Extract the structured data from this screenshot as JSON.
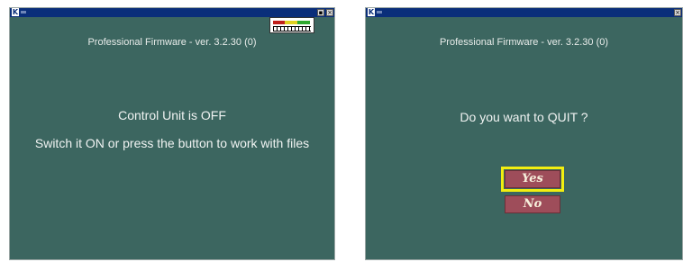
{
  "left_window": {
    "titlebar": {
      "app_icon": "k-icon",
      "buttons": [
        "minimize-icon",
        "close-icon"
      ]
    },
    "firmware": "Professional Firmware - ver. 3.2.30 (0)",
    "status_line1": "Control Unit is OFF",
    "status_line2": "Switch it ON or press the button to work with files",
    "meter": {
      "colors": [
        "#c0201c",
        "#e0d020",
        "#2ea82e"
      ]
    }
  },
  "right_window": {
    "titlebar": {
      "app_icon": "k-icon",
      "buttons": [
        "close-icon"
      ]
    },
    "firmware": "Professional Firmware - ver. 3.2.30 (0)",
    "question": "Do you want to QUIT ?",
    "yes_label": "Yes",
    "no_label": "No",
    "focused_button": "Yes",
    "colors": {
      "button": "#9e4d5a",
      "focus": "#f2ee10",
      "background": "#3c6660"
    }
  }
}
